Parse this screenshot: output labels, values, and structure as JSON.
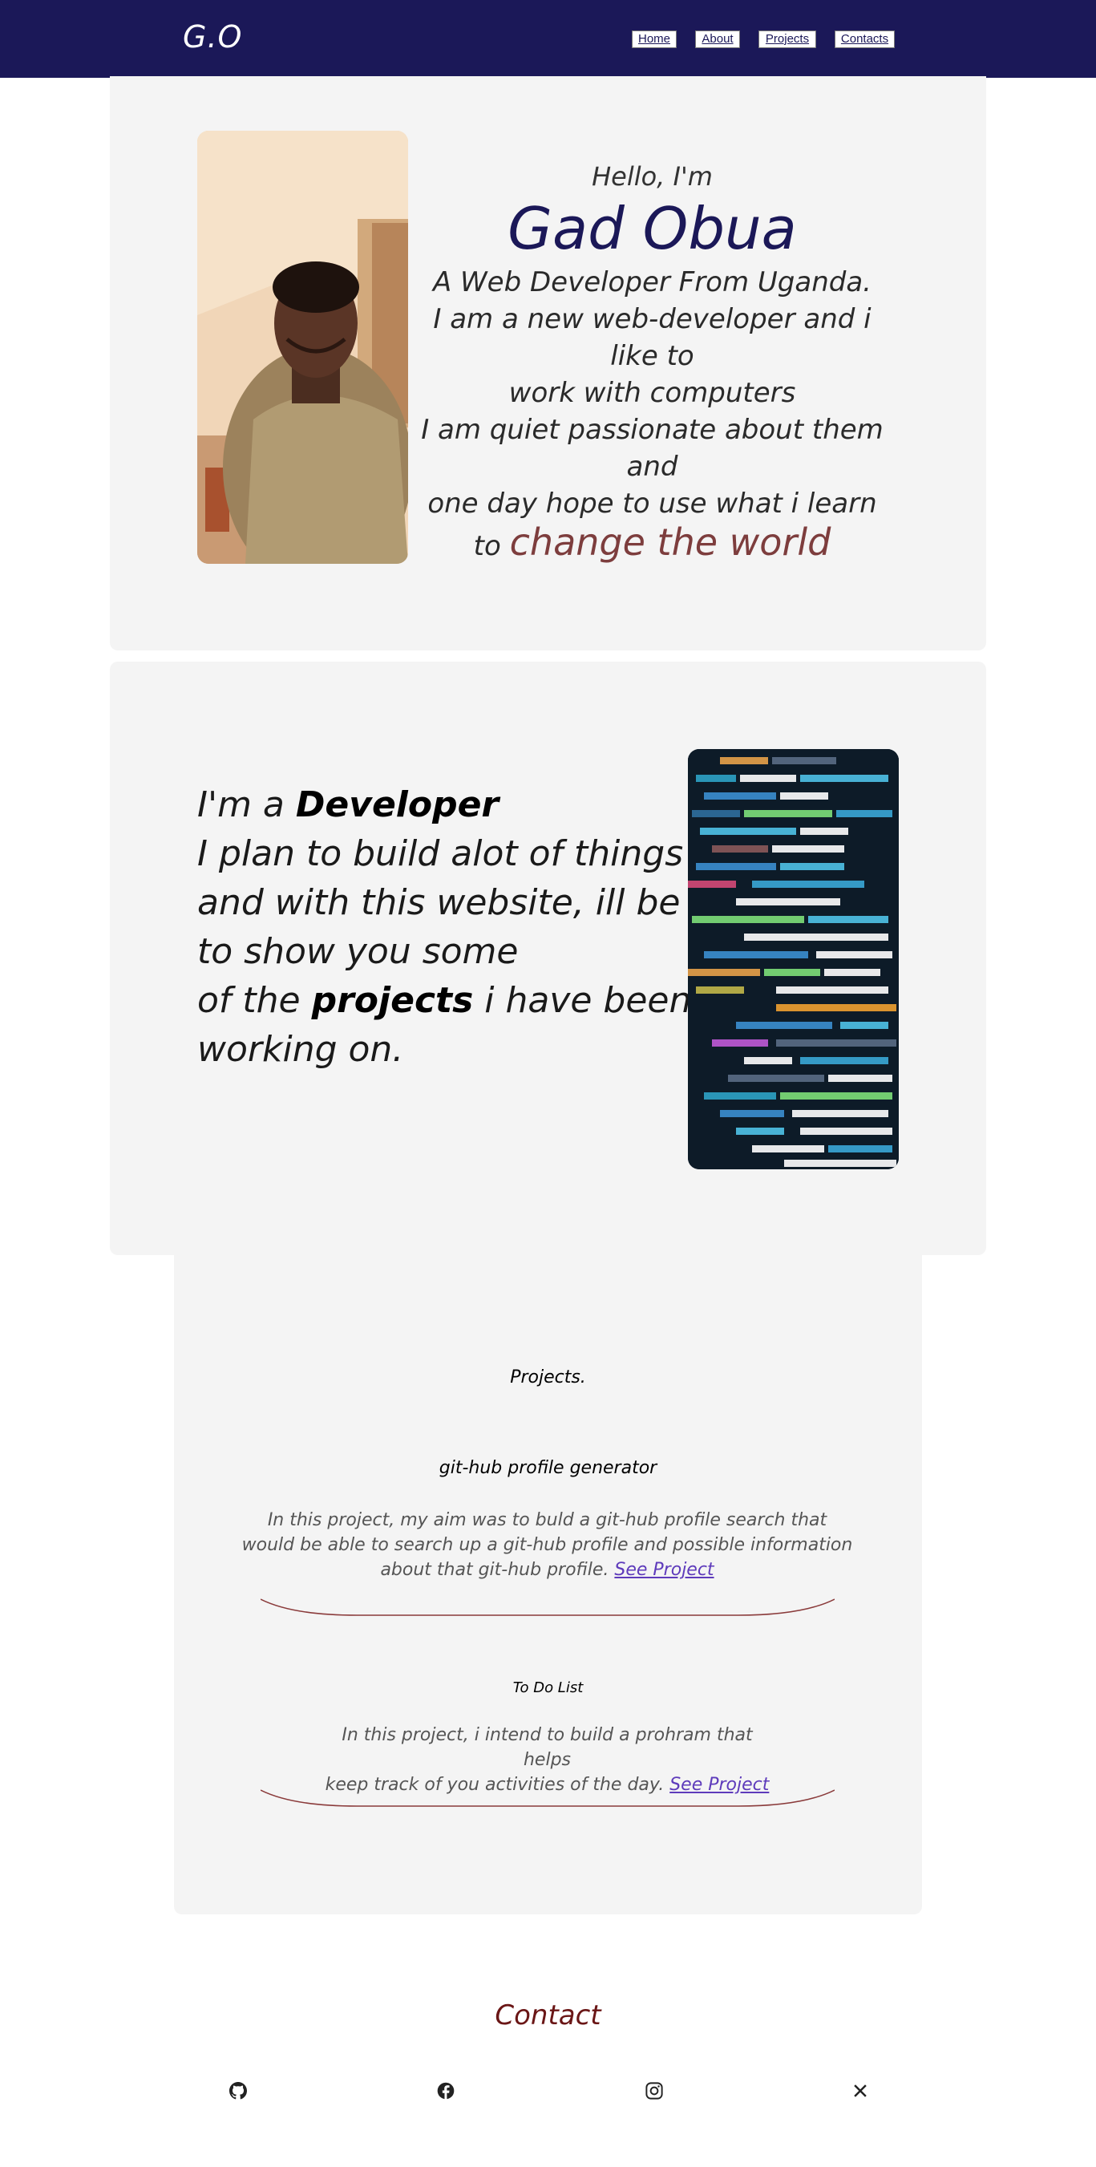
{
  "nav": {
    "logo": "G.O",
    "links": [
      "Home",
      "About",
      "Projects",
      "Contacts"
    ]
  },
  "hero": {
    "greeting": "Hello, I'm",
    "name": "Gad Obua",
    "lines": [
      "A Web Developer From Uganda.",
      "I am a new web-developer and i like to",
      "work with computers",
      "I am quiet passionate about them and",
      "one day hope to use what i learn"
    ],
    "closing_prefix": "to",
    "closing_highlight": "change the world"
  },
  "developer": {
    "line1_prefix": "I'm a",
    "line1_bold": "Developer",
    "line2": "I plan to build alot of things",
    "line3": "and with this website, ill be able",
    "line4": "to show you some",
    "line5_prefix": "of the",
    "line5_bold": "projects",
    "line5_suffix": "i have been",
    "line6": "working on."
  },
  "projects": {
    "heading": "Projects.",
    "items": [
      {
        "title": "git-hub profile generator",
        "desc_lines": [
          "In this project, my aim was to buld a git-hub profile search that",
          "would be able to search up a git-hub profile and possible information",
          "about that git-hub profile."
        ],
        "link": "See Project"
      },
      {
        "title": "To Do List",
        "desc_lines": [
          "In this project, i intend to build a prohram that helps",
          "keep track of you activities of the day."
        ],
        "link": "See Project"
      }
    ]
  },
  "contact": {
    "title": "Contact",
    "icons": [
      "github-icon",
      "facebook-icon",
      "instagram-icon",
      "x-icon"
    ]
  },
  "colors": {
    "nav_bg": "#1b1858",
    "accent_name": "#1b1858",
    "highlight": "#7d3d3d",
    "contact": "#6a1616",
    "card_bg": "#f4f4f4"
  }
}
